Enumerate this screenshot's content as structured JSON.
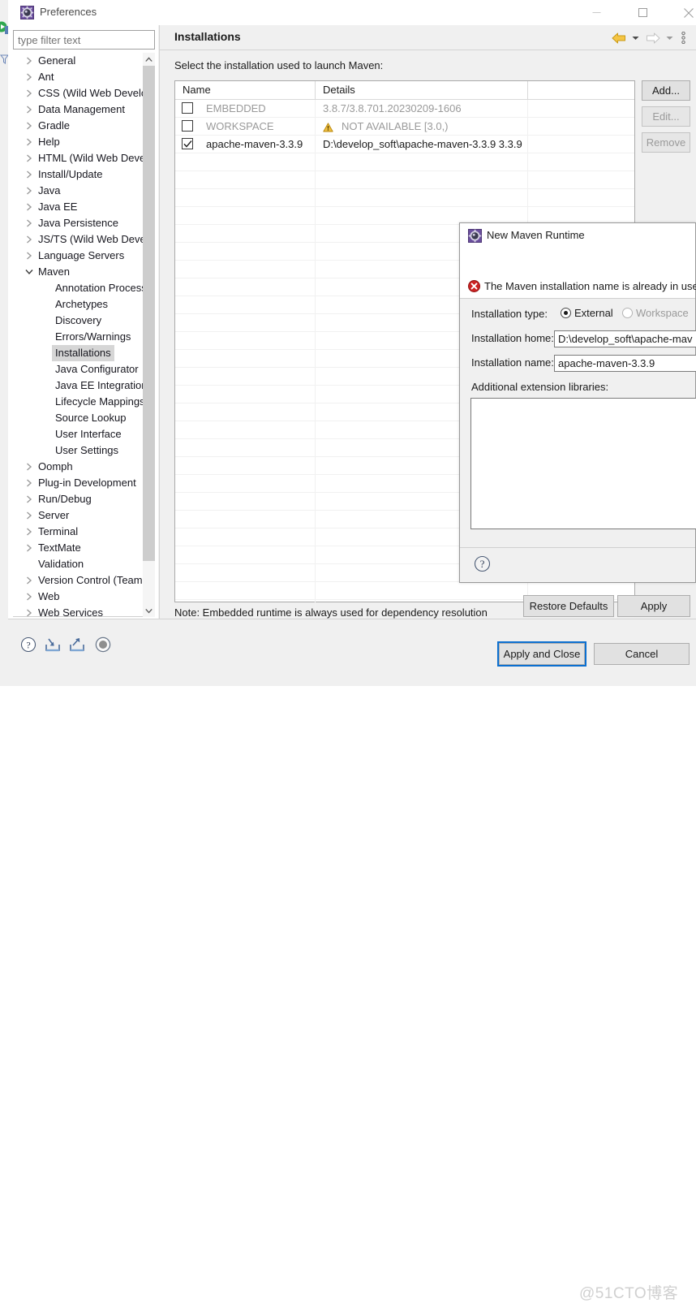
{
  "window": {
    "title": "Preferences",
    "title_icon": "preferences-gear-icon",
    "controls": {
      "minimize": "minimize-icon",
      "maximize": "maximize-icon",
      "close": "close-icon"
    }
  },
  "filter": {
    "placeholder": "type filter text",
    "value": ""
  },
  "tree": {
    "items": [
      {
        "label": "General",
        "level": 1,
        "arrow": "collapsed",
        "selected": false
      },
      {
        "label": "Ant",
        "level": 1,
        "arrow": "collapsed",
        "selected": false
      },
      {
        "label": "CSS (Wild Web Develc",
        "level": 1,
        "arrow": "collapsed",
        "selected": false
      },
      {
        "label": "Data Management",
        "level": 1,
        "arrow": "collapsed",
        "selected": false
      },
      {
        "label": "Gradle",
        "level": 1,
        "arrow": "collapsed",
        "selected": false
      },
      {
        "label": "Help",
        "level": 1,
        "arrow": "collapsed",
        "selected": false
      },
      {
        "label": "HTML (Wild Web Deve",
        "level": 1,
        "arrow": "collapsed",
        "selected": false
      },
      {
        "label": "Install/Update",
        "level": 1,
        "arrow": "collapsed",
        "selected": false
      },
      {
        "label": "Java",
        "level": 1,
        "arrow": "collapsed",
        "selected": false
      },
      {
        "label": "Java EE",
        "level": 1,
        "arrow": "collapsed",
        "selected": false
      },
      {
        "label": "Java Persistence",
        "level": 1,
        "arrow": "collapsed",
        "selected": false
      },
      {
        "label": "JS/TS (Wild Web Deve",
        "level": 1,
        "arrow": "collapsed",
        "selected": false
      },
      {
        "label": "Language Servers",
        "level": 1,
        "arrow": "collapsed",
        "selected": false
      },
      {
        "label": "Maven",
        "level": 1,
        "arrow": "expanded",
        "selected": false
      },
      {
        "label": "Annotation Process",
        "level": 2,
        "arrow": "none",
        "selected": false
      },
      {
        "label": "Archetypes",
        "level": 2,
        "arrow": "none",
        "selected": false
      },
      {
        "label": "Discovery",
        "level": 2,
        "arrow": "none",
        "selected": false
      },
      {
        "label": "Errors/Warnings",
        "level": 2,
        "arrow": "none",
        "selected": false
      },
      {
        "label": "Installations",
        "level": 2,
        "arrow": "none",
        "selected": true
      },
      {
        "label": "Java Configurator",
        "level": 2,
        "arrow": "none",
        "selected": false
      },
      {
        "label": "Java EE Integration",
        "level": 2,
        "arrow": "none",
        "selected": false
      },
      {
        "label": "Lifecycle Mappings",
        "level": 2,
        "arrow": "none",
        "selected": false
      },
      {
        "label": "Source Lookup",
        "level": 2,
        "arrow": "none",
        "selected": false
      },
      {
        "label": "User Interface",
        "level": 2,
        "arrow": "none",
        "selected": false
      },
      {
        "label": "User Settings",
        "level": 2,
        "arrow": "none",
        "selected": false
      },
      {
        "label": "Oomph",
        "level": 1,
        "arrow": "collapsed",
        "selected": false
      },
      {
        "label": "Plug-in Development",
        "level": 1,
        "arrow": "collapsed",
        "selected": false
      },
      {
        "label": "Run/Debug",
        "level": 1,
        "arrow": "collapsed",
        "selected": false
      },
      {
        "label": "Server",
        "level": 1,
        "arrow": "collapsed",
        "selected": false
      },
      {
        "label": "Terminal",
        "level": 1,
        "arrow": "collapsed",
        "selected": false
      },
      {
        "label": "TextMate",
        "level": 1,
        "arrow": "collapsed",
        "selected": false
      },
      {
        "label": "Validation",
        "level": 1,
        "arrow": "none",
        "selected": false
      },
      {
        "label": "Version Control (Team",
        "level": 1,
        "arrow": "collapsed",
        "selected": false
      },
      {
        "label": "Web",
        "level": 1,
        "arrow": "collapsed",
        "selected": false
      },
      {
        "label": "Web Services",
        "level": 1,
        "arrow": "collapsed",
        "selected": false
      }
    ]
  },
  "page": {
    "title": "Installations",
    "description": "Select the installation used to launch Maven:",
    "note": "Note: Embedded runtime is always used for dependency resolution",
    "header_icons": {
      "back": "back-arrow-icon",
      "back_menu": "chevron-down-icon",
      "forward": "forward-arrow-icon",
      "forward_menu": "chevron-down-icon",
      "view_menu": "vertical-dots-icon"
    }
  },
  "table": {
    "columns": [
      "Name",
      "Details",
      ""
    ],
    "rows": [
      {
        "checked": false,
        "enabled": false,
        "name": "EMBEDDED",
        "details": "3.8.7/3.8.701.20230209-1606",
        "details_icon": ""
      },
      {
        "checked": false,
        "enabled": false,
        "name": "WORKSPACE",
        "details": "NOT AVAILABLE [3.0,)",
        "details_icon": "warning-icon"
      },
      {
        "checked": true,
        "enabled": true,
        "name": "apache-maven-3.3.9",
        "details": "D:\\develop_soft\\apache-maven-3.3.9 3.3.9",
        "details_icon": ""
      }
    ]
  },
  "side_buttons": [
    {
      "label": "Add...",
      "enabled": true
    },
    {
      "label": "Edit...",
      "enabled": false
    },
    {
      "label": "Remove",
      "enabled": false
    }
  ],
  "page_buttons": {
    "restore_defaults": "Restore Defaults",
    "apply": "Apply"
  },
  "bottom_bar": {
    "icons": [
      {
        "name": "help-icon"
      },
      {
        "name": "import-icon"
      },
      {
        "name": "export-icon"
      },
      {
        "name": "oomph-record-icon"
      }
    ],
    "apply_and_close": "Apply and Close",
    "cancel": "Cancel",
    "watermark": "@51CTO博客"
  },
  "dialog": {
    "title": "New Maven Runtime",
    "title_icon": "maven-gear-icon",
    "error_icon": "error-icon",
    "error_message": "The Maven installation name is already in use",
    "labels": {
      "installation_type": "Installation type:",
      "installation_home": "Installation home:",
      "installation_name": "Installation name:",
      "additional_libraries": "Additional extension libraries:"
    },
    "radios": [
      {
        "label": "External",
        "selected": true,
        "enabled": true
      },
      {
        "label": "Workspace",
        "selected": false,
        "enabled": false
      }
    ],
    "installation_home_value": "D:\\develop_soft\\apache-mav",
    "installation_name_value": "apache-maven-3.3.9",
    "extension_libraries": [],
    "help_icon": "help-icon"
  }
}
